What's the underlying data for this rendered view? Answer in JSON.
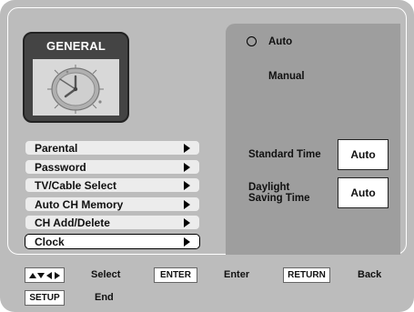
{
  "general": {
    "title": "GENERAL",
    "icon": "clock-icon"
  },
  "menu": {
    "items": [
      {
        "label": "Parental",
        "selected": false
      },
      {
        "label": "Password",
        "selected": false
      },
      {
        "label": "TV/Cable Select",
        "selected": false
      },
      {
        "label": "Auto CH Memory",
        "selected": false
      },
      {
        "label": "CH Add/Delete",
        "selected": false
      },
      {
        "label": "Clock",
        "selected": true
      }
    ],
    "arrow_icon": "triangle-right-icon"
  },
  "clock_panel": {
    "auto_label": "Auto",
    "manual_label": "Manual",
    "standard_time_label": "Standard Time",
    "standard_time_value": "Auto",
    "daylight_label_line1": "Daylight",
    "daylight_label_line2": "Saving Time",
    "daylight_value": "Auto"
  },
  "footer": {
    "nav_icon": "arrow-keys-icon",
    "select_label": "Select",
    "enter_key": "ENTER",
    "enter_label": "Enter",
    "return_key": "RETURN",
    "back_label": "Back",
    "setup_key": "SETUP",
    "end_label": "End"
  },
  "colors": {
    "screen_bg": "#bcbcbc",
    "panel_bg": "#9e9e9e",
    "tile_bg": "#444444",
    "menu_bg": "#ececec"
  }
}
